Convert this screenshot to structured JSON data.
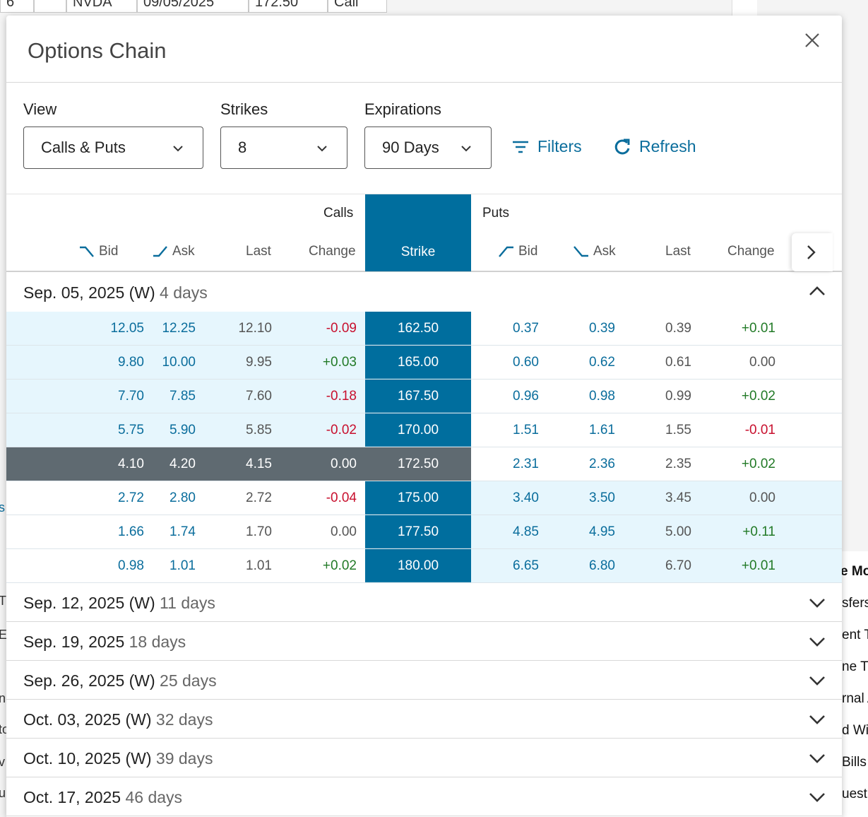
{
  "background": {
    "toolbar_cells": [
      "6",
      "",
      "NVDA",
      "09/05/2025",
      "172.50",
      "Call"
    ],
    "right_side_fragments": [
      "e Mo",
      "sfers",
      "ent T",
      "ne Tr",
      "rnal A",
      "d Wir",
      "Bills",
      "uest"
    ],
    "left_side_fragments": [
      "s",
      "T",
      "E",
      "n",
      "to",
      "v",
      "u"
    ]
  },
  "modal": {
    "title": "Options Chain",
    "close_icon": "close-icon"
  },
  "controls": {
    "view_label": "View",
    "view_value": "Calls & Puts",
    "strikes_label": "Strikes",
    "strikes_value": "8",
    "expirations_label": "Expirations",
    "expirations_value": "90 Days",
    "filters_label": "Filters",
    "refresh_label": "Refresh"
  },
  "table": {
    "calls_group": "Calls",
    "puts_group": "Puts",
    "strike_header": "Strike",
    "calls_columns": [
      "Bid",
      "Ask",
      "Last",
      "Change"
    ],
    "puts_columns": [
      "Bid",
      "Ask",
      "Last",
      "Change"
    ]
  },
  "expanded_expiration": {
    "date": "Sep. 05, 2025 (W)",
    "days": "4 days"
  },
  "rows": [
    {
      "call_bid": "12.05",
      "call_ask": "12.25",
      "call_last": "12.10",
      "call_change": "-0.09",
      "strike": "162.50",
      "put_bid": "0.37",
      "put_ask": "0.39",
      "put_last": "0.39",
      "put_change": "+0.01"
    },
    {
      "call_bid": "9.80",
      "call_ask": "10.00",
      "call_last": "9.95",
      "call_change": "+0.03",
      "strike": "165.00",
      "put_bid": "0.60",
      "put_ask": "0.62",
      "put_last": "0.61",
      "put_change": "0.00"
    },
    {
      "call_bid": "7.70",
      "call_ask": "7.85",
      "call_last": "7.60",
      "call_change": "-0.18",
      "strike": "167.50",
      "put_bid": "0.96",
      "put_ask": "0.98",
      "put_last": "0.99",
      "put_change": "+0.02"
    },
    {
      "call_bid": "5.75",
      "call_ask": "5.90",
      "call_last": "5.85",
      "call_change": "-0.02",
      "strike": "170.00",
      "put_bid": "1.51",
      "put_ask": "1.61",
      "put_last": "1.55",
      "put_change": "-0.01"
    },
    {
      "call_bid": "4.10",
      "call_ask": "4.20",
      "call_last": "4.15",
      "call_change": "0.00",
      "strike": "172.50",
      "put_bid": "2.31",
      "put_ask": "2.36",
      "put_last": "2.35",
      "put_change": "+0.02"
    },
    {
      "call_bid": "2.72",
      "call_ask": "2.80",
      "call_last": "2.72",
      "call_change": "-0.04",
      "strike": "175.00",
      "put_bid": "3.40",
      "put_ask": "3.50",
      "put_last": "3.45",
      "put_change": "0.00"
    },
    {
      "call_bid": "1.66",
      "call_ask": "1.74",
      "call_last": "1.70",
      "call_change": "0.00",
      "strike": "177.50",
      "put_bid": "4.85",
      "put_ask": "4.95",
      "put_last": "5.00",
      "put_change": "+0.11"
    },
    {
      "call_bid": "0.98",
      "call_ask": "1.01",
      "call_last": "1.01",
      "call_change": "+0.02",
      "strike": "180.00",
      "put_bid": "6.65",
      "put_ask": "6.80",
      "put_last": "6.70",
      "put_change": "+0.01"
    }
  ],
  "collapsed_expirations": [
    {
      "date": "Sep. 12, 2025 (W)",
      "days": "11 days"
    },
    {
      "date": "Sep. 19, 2025",
      "days": "18 days"
    },
    {
      "date": "Sep. 26, 2025 (W)",
      "days": "25 days"
    },
    {
      "date": "Oct. 03, 2025 (W)",
      "days": "32 days"
    },
    {
      "date": "Oct. 10, 2025 (W)",
      "days": "39 days"
    },
    {
      "date": "Oct. 17, 2025",
      "days": "46 days"
    }
  ],
  "colors": {
    "accent": "#006e9e",
    "link": "#0a6d9c",
    "in_the_money": "#e6f6fd",
    "at_the_money": "#5f6a71",
    "negative": "#c8102e",
    "positive": "#227a27"
  }
}
